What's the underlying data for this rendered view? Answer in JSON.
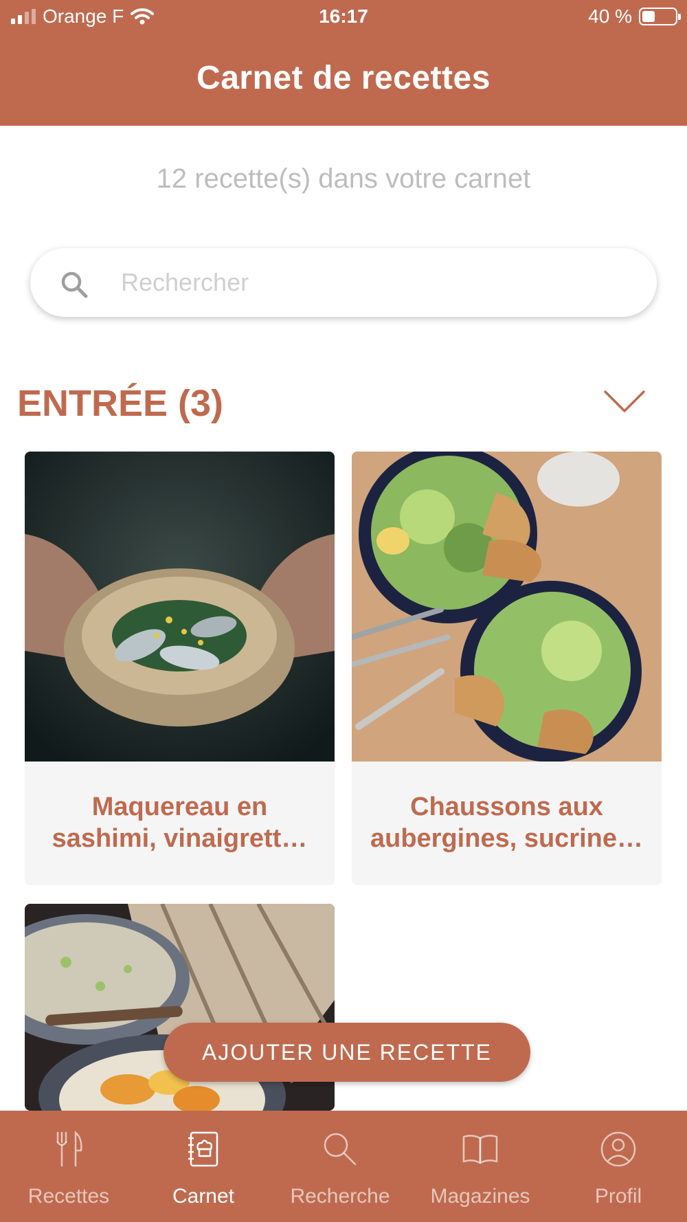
{
  "status_bar": {
    "carrier": "Orange F",
    "time": "16:17",
    "battery": "40 %",
    "battery_level": 0.4
  },
  "header": {
    "title": "Carnet de recettes"
  },
  "summary": {
    "count_text": "12 recette(s) dans votre carnet"
  },
  "search": {
    "placeholder": "Rechercher"
  },
  "section": {
    "title": "ENTRÉE (3)"
  },
  "recipes": [
    {
      "title": "Maquereau en sashimi, vinaigrett…"
    },
    {
      "title": "Chaussons aux aubergines, sucrine…"
    },
    {
      "title": ""
    }
  ],
  "add_button": {
    "label": "AJOUTER UNE RECETTE"
  },
  "tabs": [
    {
      "label": "Recettes",
      "icon": "fork-knife-icon",
      "active": false
    },
    {
      "label": "Carnet",
      "icon": "notebook-icon",
      "active": true
    },
    {
      "label": "Recherche",
      "icon": "search-icon",
      "active": false
    },
    {
      "label": "Magazines",
      "icon": "open-book-icon",
      "active": false
    },
    {
      "label": "Profil",
      "icon": "profile-icon",
      "active": false
    }
  ],
  "colors": {
    "brand": "#bf6a4f",
    "muted_text": "#bdbdbd"
  }
}
